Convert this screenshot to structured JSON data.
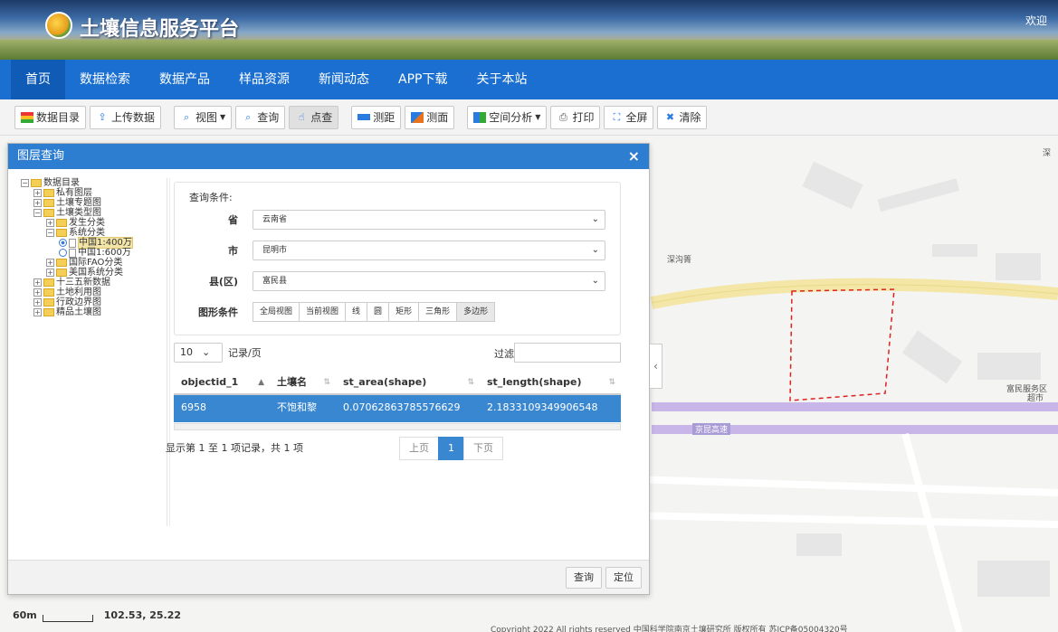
{
  "header": {
    "site_title": "土壤信息服务平台",
    "welcome": "欢迎"
  },
  "nav": [
    {
      "label": "首页",
      "active": true
    },
    {
      "label": "数据检索"
    },
    {
      "label": "数据产品"
    },
    {
      "label": "样品资源"
    },
    {
      "label": "新闻动态"
    },
    {
      "label": "APP下载"
    },
    {
      "label": "关于本站"
    }
  ],
  "toolbar": {
    "catalog": "数据目录",
    "upload": "上传数据",
    "view": "视图",
    "query": "查询",
    "point_query": "点查",
    "measure_distance": "测距",
    "measure_area": "测面",
    "spatial_analysis": "空间分析",
    "print": "打印",
    "fullscreen": "全屏",
    "clear": "清除"
  },
  "dialog": {
    "title": "图层查询",
    "close": "×",
    "tree": [
      {
        "level": 0,
        "pm": "−",
        "label": "数据目录"
      },
      {
        "level": 1,
        "pm": "+",
        "label": "私有图层"
      },
      {
        "level": 1,
        "pm": "+",
        "label": "土壤专题图"
      },
      {
        "level": 1,
        "pm": "−",
        "label": "土壤类型图"
      },
      {
        "level": 2,
        "pm": "+",
        "label": "发生分类"
      },
      {
        "level": 2,
        "pm": "−",
        "label": "系统分类"
      },
      {
        "level": 3,
        "radio": true,
        "on": true,
        "label": "中国1:400万"
      },
      {
        "level": 3,
        "radio": true,
        "on": false,
        "label": "中国1:600万"
      },
      {
        "level": 2,
        "pm": "+",
        "label": "国际FAO分类"
      },
      {
        "level": 2,
        "pm": "+",
        "label": "美国系统分类"
      },
      {
        "level": 1,
        "pm": "+",
        "label": "十三五新数据"
      },
      {
        "level": 1,
        "pm": "+",
        "label": "土地利用图"
      },
      {
        "level": 1,
        "pm": "+",
        "label": "行政边界图"
      },
      {
        "level": 1,
        "pm": "+",
        "label": "精品土壤图"
      }
    ],
    "conditions_label": "查询条件:",
    "province_label": "省",
    "province_value": "云南省",
    "city_label": "市",
    "city_value": "昆明市",
    "county_label": "县(区)",
    "county_value": "富民县",
    "shape_label": "图形条件",
    "shape_buttons": [
      "全局视图",
      "当前视图",
      "线",
      "圆",
      "矩形",
      "三角形",
      "多边形"
    ],
    "page_size": "10",
    "per_page_label": "记录/页",
    "filter_label": "过滤:",
    "columns": [
      "objectid_1",
      "土壤名",
      "st_area(shape)",
      "st_length(shape)"
    ],
    "rows": [
      [
        "6958",
        "不饱和黎",
        "0.07062863785576629",
        "2.1833109349906548"
      ]
    ],
    "info": "显示第 1 至 1 项记录，共 1 项",
    "prev": "上页",
    "page": "1",
    "next": "下页",
    "query_btn": "查询",
    "locate_btn": "定位"
  },
  "map": {
    "scale_label": "60m",
    "coords": "102.53, 25.22",
    "labels": [
      "深沟箐",
      "富民服务区",
      "超市",
      "京昆高速",
      "深"
    ],
    "copyright": "Copyright 2022 All rights reserved 中国科学院南京土壤研究所 版权所有 苏ICP备05004320号"
  }
}
